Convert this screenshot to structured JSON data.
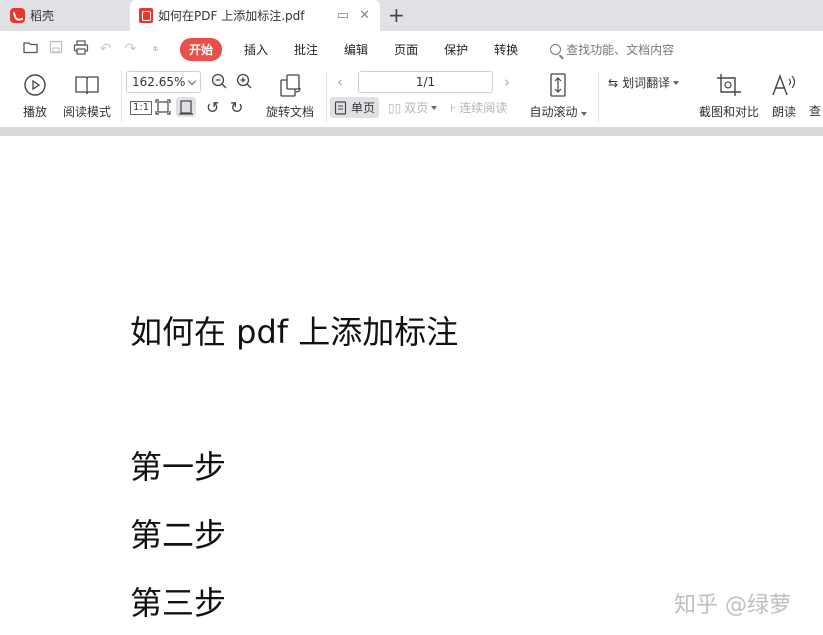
{
  "tabs": {
    "home_label": "稻壳",
    "doc_label": "如何在PDF 上添加标注.pdf"
  },
  "menu": {
    "items": [
      "开始",
      "插入",
      "批注",
      "编辑",
      "页面",
      "保护",
      "转换"
    ],
    "search_placeholder": "查找功能、文档内容"
  },
  "ribbon": {
    "play": "播放",
    "read_mode": "阅读模式",
    "zoom": "162.65%",
    "actual_size": "1:1",
    "rotate_doc": "旋转文档",
    "page": "1/1",
    "single_page": "单页",
    "double_page": "双页",
    "continuous": "连续阅读",
    "auto_scroll": "自动滚动",
    "translate": "划词翻译",
    "screenshot_compare": "截图和对比",
    "read_aloud": "朗读",
    "find_partial": "查"
  },
  "document": {
    "title": "如何在 pdf 上添加标注",
    "steps": [
      "第一步",
      "第二步",
      "第三步"
    ]
  },
  "watermark": "知乎 @绿萝",
  "colors": {
    "accent": "#e8514a",
    "tab_bar": "#dfe1e5"
  }
}
